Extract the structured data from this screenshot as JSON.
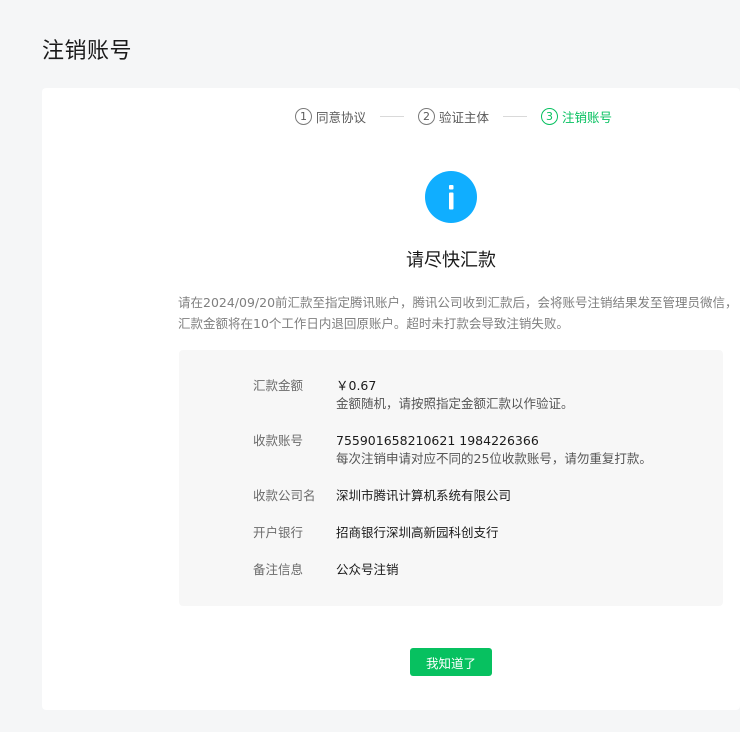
{
  "page": {
    "title": "注销账号"
  },
  "steps": [
    {
      "num": "1",
      "label": "同意协议",
      "active": false
    },
    {
      "num": "2",
      "label": "验证主体",
      "active": false
    },
    {
      "num": "3",
      "label": "注销账号",
      "active": true
    }
  ],
  "icon": {
    "name": "info-icon",
    "glyph": "i",
    "color": "#10aeff"
  },
  "heading": "请尽快汇款",
  "description": "请在2024/09/20前汇款至指定腾讯账户，腾讯公司收到汇款后，会将账号注销结果发至管理员微信，汇款金额将在10个工作日内退回原账户。超时未打款会导致注销失败。",
  "details": {
    "amount": {
      "label": "汇款金额",
      "value": "￥0.67",
      "note": "金额随机，请按照指定金额汇款以作验证。"
    },
    "account": {
      "label": "收款账号",
      "value": "755901658210621 1984226366",
      "note": "每次注销申请对应不同的25位收款账号，请勿重复打款。"
    },
    "company": {
      "label": "收款公司名",
      "value": "深圳市腾讯计算机系统有限公司"
    },
    "bank": {
      "label": "开户银行",
      "value": "招商银行深圳高新园科创支行"
    },
    "remark": {
      "label": "备注信息",
      "value": "公众号注销"
    }
  },
  "button": {
    "label": "我知道了"
  },
  "colors": {
    "accent": "#07c160",
    "info": "#10aeff",
    "background": "#f5f6f7"
  }
}
